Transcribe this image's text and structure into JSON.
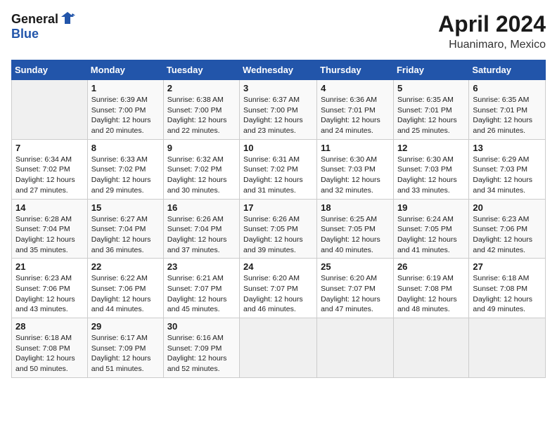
{
  "header": {
    "logo_general": "General",
    "logo_blue": "Blue",
    "month_title": "April 2024",
    "subtitle": "Huanimaro, Mexico"
  },
  "days_of_week": [
    "Sunday",
    "Monday",
    "Tuesday",
    "Wednesday",
    "Thursday",
    "Friday",
    "Saturday"
  ],
  "weeks": [
    [
      {
        "day": "",
        "info": ""
      },
      {
        "day": "1",
        "info": "Sunrise: 6:39 AM\nSunset: 7:00 PM\nDaylight: 12 hours\nand 20 minutes."
      },
      {
        "day": "2",
        "info": "Sunrise: 6:38 AM\nSunset: 7:00 PM\nDaylight: 12 hours\nand 22 minutes."
      },
      {
        "day": "3",
        "info": "Sunrise: 6:37 AM\nSunset: 7:00 PM\nDaylight: 12 hours\nand 23 minutes."
      },
      {
        "day": "4",
        "info": "Sunrise: 6:36 AM\nSunset: 7:01 PM\nDaylight: 12 hours\nand 24 minutes."
      },
      {
        "day": "5",
        "info": "Sunrise: 6:35 AM\nSunset: 7:01 PM\nDaylight: 12 hours\nand 25 minutes."
      },
      {
        "day": "6",
        "info": "Sunrise: 6:35 AM\nSunset: 7:01 PM\nDaylight: 12 hours\nand 26 minutes."
      }
    ],
    [
      {
        "day": "7",
        "info": "Sunrise: 6:34 AM\nSunset: 7:02 PM\nDaylight: 12 hours\nand 27 minutes."
      },
      {
        "day": "8",
        "info": "Sunrise: 6:33 AM\nSunset: 7:02 PM\nDaylight: 12 hours\nand 29 minutes."
      },
      {
        "day": "9",
        "info": "Sunrise: 6:32 AM\nSunset: 7:02 PM\nDaylight: 12 hours\nand 30 minutes."
      },
      {
        "day": "10",
        "info": "Sunrise: 6:31 AM\nSunset: 7:02 PM\nDaylight: 12 hours\nand 31 minutes."
      },
      {
        "day": "11",
        "info": "Sunrise: 6:30 AM\nSunset: 7:03 PM\nDaylight: 12 hours\nand 32 minutes."
      },
      {
        "day": "12",
        "info": "Sunrise: 6:30 AM\nSunset: 7:03 PM\nDaylight: 12 hours\nand 33 minutes."
      },
      {
        "day": "13",
        "info": "Sunrise: 6:29 AM\nSunset: 7:03 PM\nDaylight: 12 hours\nand 34 minutes."
      }
    ],
    [
      {
        "day": "14",
        "info": "Sunrise: 6:28 AM\nSunset: 7:04 PM\nDaylight: 12 hours\nand 35 minutes."
      },
      {
        "day": "15",
        "info": "Sunrise: 6:27 AM\nSunset: 7:04 PM\nDaylight: 12 hours\nand 36 minutes."
      },
      {
        "day": "16",
        "info": "Sunrise: 6:26 AM\nSunset: 7:04 PM\nDaylight: 12 hours\nand 37 minutes."
      },
      {
        "day": "17",
        "info": "Sunrise: 6:26 AM\nSunset: 7:05 PM\nDaylight: 12 hours\nand 39 minutes."
      },
      {
        "day": "18",
        "info": "Sunrise: 6:25 AM\nSunset: 7:05 PM\nDaylight: 12 hours\nand 40 minutes."
      },
      {
        "day": "19",
        "info": "Sunrise: 6:24 AM\nSunset: 7:05 PM\nDaylight: 12 hours\nand 41 minutes."
      },
      {
        "day": "20",
        "info": "Sunrise: 6:23 AM\nSunset: 7:06 PM\nDaylight: 12 hours\nand 42 minutes."
      }
    ],
    [
      {
        "day": "21",
        "info": "Sunrise: 6:23 AM\nSunset: 7:06 PM\nDaylight: 12 hours\nand 43 minutes."
      },
      {
        "day": "22",
        "info": "Sunrise: 6:22 AM\nSunset: 7:06 PM\nDaylight: 12 hours\nand 44 minutes."
      },
      {
        "day": "23",
        "info": "Sunrise: 6:21 AM\nSunset: 7:07 PM\nDaylight: 12 hours\nand 45 minutes."
      },
      {
        "day": "24",
        "info": "Sunrise: 6:20 AM\nSunset: 7:07 PM\nDaylight: 12 hours\nand 46 minutes."
      },
      {
        "day": "25",
        "info": "Sunrise: 6:20 AM\nSunset: 7:07 PM\nDaylight: 12 hours\nand 47 minutes."
      },
      {
        "day": "26",
        "info": "Sunrise: 6:19 AM\nSunset: 7:08 PM\nDaylight: 12 hours\nand 48 minutes."
      },
      {
        "day": "27",
        "info": "Sunrise: 6:18 AM\nSunset: 7:08 PM\nDaylight: 12 hours\nand 49 minutes."
      }
    ],
    [
      {
        "day": "28",
        "info": "Sunrise: 6:18 AM\nSunset: 7:08 PM\nDaylight: 12 hours\nand 50 minutes."
      },
      {
        "day": "29",
        "info": "Sunrise: 6:17 AM\nSunset: 7:09 PM\nDaylight: 12 hours\nand 51 minutes."
      },
      {
        "day": "30",
        "info": "Sunrise: 6:16 AM\nSunset: 7:09 PM\nDaylight: 12 hours\nand 52 minutes."
      },
      {
        "day": "",
        "info": ""
      },
      {
        "day": "",
        "info": ""
      },
      {
        "day": "",
        "info": ""
      },
      {
        "day": "",
        "info": ""
      }
    ]
  ]
}
